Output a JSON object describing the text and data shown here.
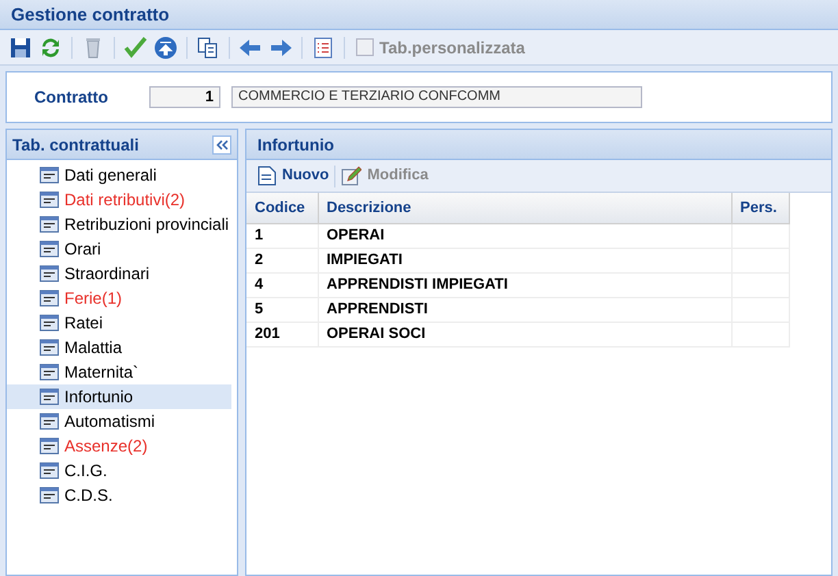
{
  "window": {
    "title": "Gestione contratto"
  },
  "toolbar": {
    "custom_tab": {
      "label": "Tab.personalizzata",
      "checked": false
    }
  },
  "contract": {
    "label": "Contratto",
    "code": "1",
    "description": "COMMERCIO E TERZIARIO CONFCOMM"
  },
  "sidebar": {
    "title": "Tab. contrattuali",
    "items": [
      {
        "label": "Dati generali",
        "highlighted": false,
        "selected": false
      },
      {
        "label": "Dati retributivi(2)",
        "highlighted": true,
        "selected": false
      },
      {
        "label": "Retribuzioni provinciali",
        "highlighted": false,
        "selected": false
      },
      {
        "label": "Orari",
        "highlighted": false,
        "selected": false
      },
      {
        "label": "Straordinari",
        "highlighted": false,
        "selected": false
      },
      {
        "label": "Ferie(1)",
        "highlighted": true,
        "selected": false
      },
      {
        "label": "Ratei",
        "highlighted": false,
        "selected": false
      },
      {
        "label": "Malattia",
        "highlighted": false,
        "selected": false
      },
      {
        "label": "Maternita`",
        "highlighted": false,
        "selected": false
      },
      {
        "label": "Infortunio",
        "highlighted": false,
        "selected": true
      },
      {
        "label": "Automatismi",
        "highlighted": false,
        "selected": false
      },
      {
        "label": "Assenze(2)",
        "highlighted": true,
        "selected": false
      },
      {
        "label": "C.I.G.",
        "highlighted": false,
        "selected": false
      },
      {
        "label": "C.D.S.",
        "highlighted": false,
        "selected": false
      }
    ]
  },
  "panel": {
    "title": "Infortunio",
    "actions": [
      {
        "label": "Nuovo",
        "disabled": false,
        "kind": "new"
      },
      {
        "label": "Modifica",
        "disabled": true,
        "kind": "edit"
      }
    ],
    "table": {
      "columns": [
        "Codice",
        "Descrizione",
        "Pers."
      ],
      "rows": [
        [
          "1",
          "OPERAI",
          ""
        ],
        [
          "2",
          "IMPIEGATI",
          ""
        ],
        [
          "4",
          "APPRENDISTI IMPIEGATI",
          ""
        ],
        [
          "5",
          "APPRENDISTI",
          ""
        ],
        [
          "201",
          "OPERAI SOCI",
          ""
        ]
      ]
    }
  }
}
